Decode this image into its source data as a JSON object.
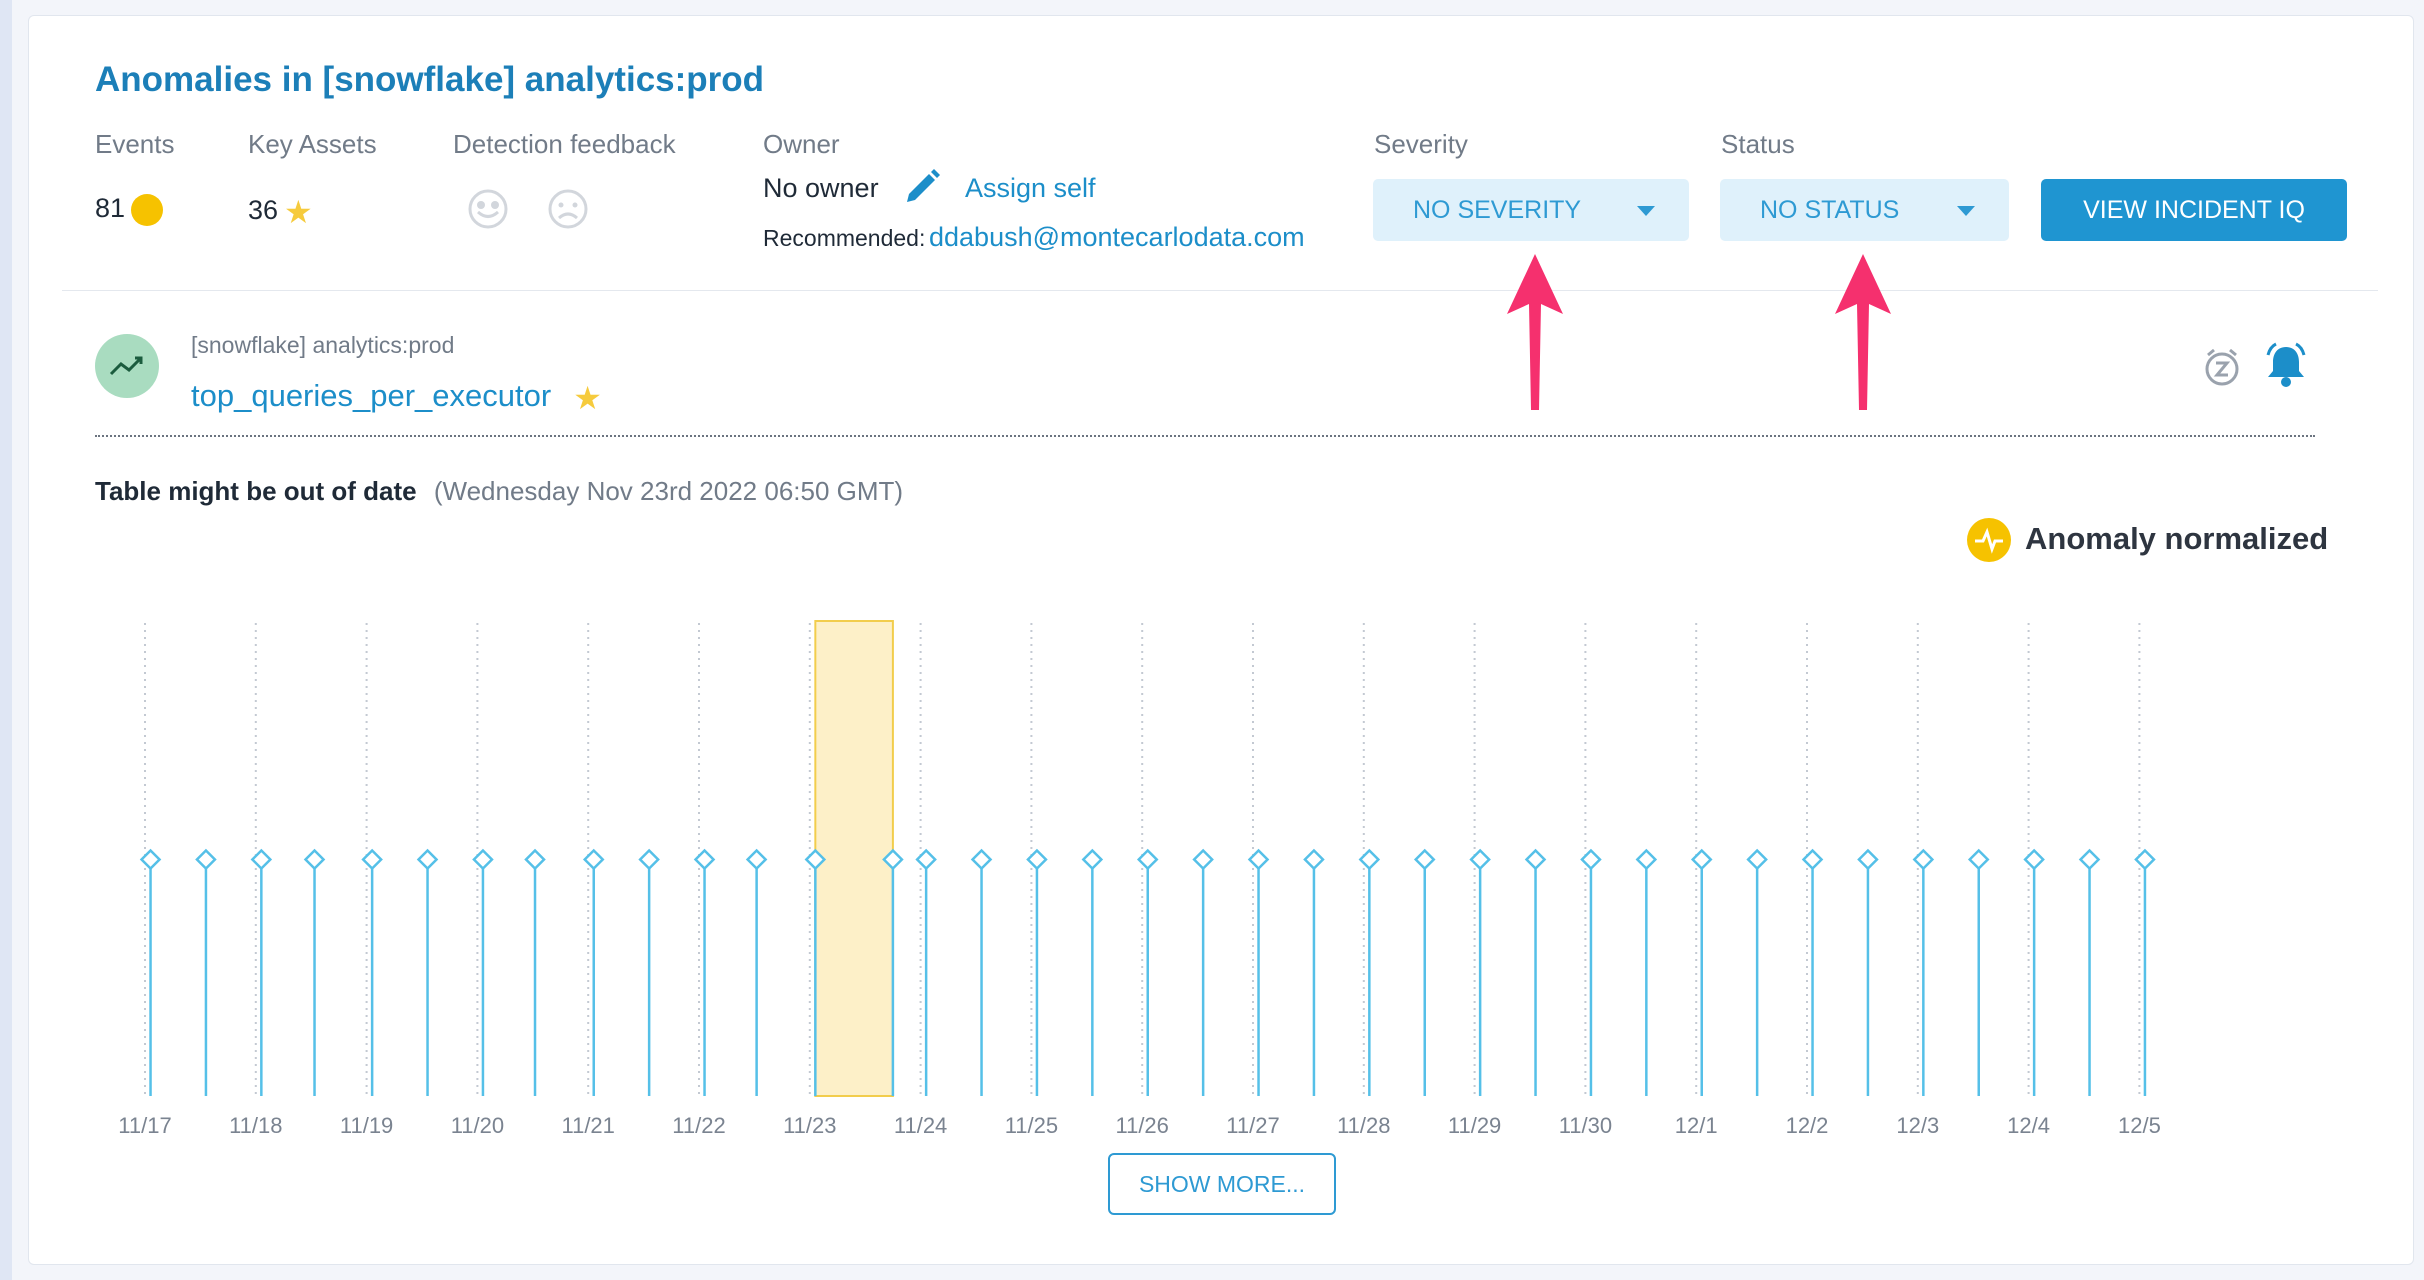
{
  "header": {
    "title": "Anomalies in [snowflake] analytics:prod"
  },
  "stats": {
    "events_label": "Events",
    "events_value": "81",
    "key_assets_label": "Key Assets",
    "key_assets_value": "36",
    "feedback_label": "Detection feedback",
    "owner_label": "Owner",
    "owner_value": "No owner",
    "assign_self": "Assign self",
    "recommended_label": "Recommended:",
    "recommended_email": "ddabush@montecarlodata.com"
  },
  "severity": {
    "label": "Severity",
    "value": "NO SEVERITY"
  },
  "status": {
    "label": "Status",
    "value": "NO STATUS"
  },
  "actions": {
    "view_incident": "VIEW INCIDENT IQ",
    "show_more": "SHOW MORE..."
  },
  "asset": {
    "path": "[snowflake] analytics:prod",
    "name": "top_queries_per_executor"
  },
  "info": {
    "message": "Table might be out of date",
    "timestamp": "(Wednesday Nov 23rd 2022 06:50 GMT)",
    "legend": "Anomaly normalized"
  },
  "colors": {
    "accent": "#1c8ec9",
    "mark": "#55c0e8",
    "highlight": "#fdf0c8",
    "highlight_border": "#f2cd4c",
    "arrow": "#f5306e"
  },
  "icons": [
    "pencil-icon",
    "trending-up-icon",
    "star-icon",
    "snooze-icon",
    "bell-icon",
    "smile-face-icon",
    "frown-face-icon",
    "heartbeat-icon",
    "caret-down-icon"
  ],
  "chart_data": {
    "type": "scatter",
    "title": "",
    "xlabel": "",
    "ylabel": "",
    "x_ticks": [
      "11/17",
      "11/18",
      "11/19",
      "11/20",
      "11/21",
      "11/22",
      "11/23",
      "11/24",
      "11/25",
      "11/26",
      "11/27",
      "11/28",
      "11/29",
      "11/30",
      "12/1",
      "12/2",
      "12/3",
      "12/4",
      "12/5"
    ],
    "x": [
      0.05,
      0.55,
      1.05,
      1.53,
      2.05,
      2.55,
      3.05,
      3.52,
      4.05,
      4.55,
      5.05,
      5.52,
      6.05,
      6.75,
      7.05,
      7.55,
      8.05,
      8.55,
      9.05,
      9.55,
      10.05,
      10.55,
      11.05,
      11.55,
      12.05,
      12.55,
      13.05,
      13.55,
      14.05,
      14.55,
      15.05,
      15.55,
      16.05,
      16.55,
      17.05,
      17.55,
      18.05
    ],
    "x_units": "days from 11/17",
    "y_level": 0.5,
    "anomaly_range": [
      6.05,
      6.75
    ]
  }
}
